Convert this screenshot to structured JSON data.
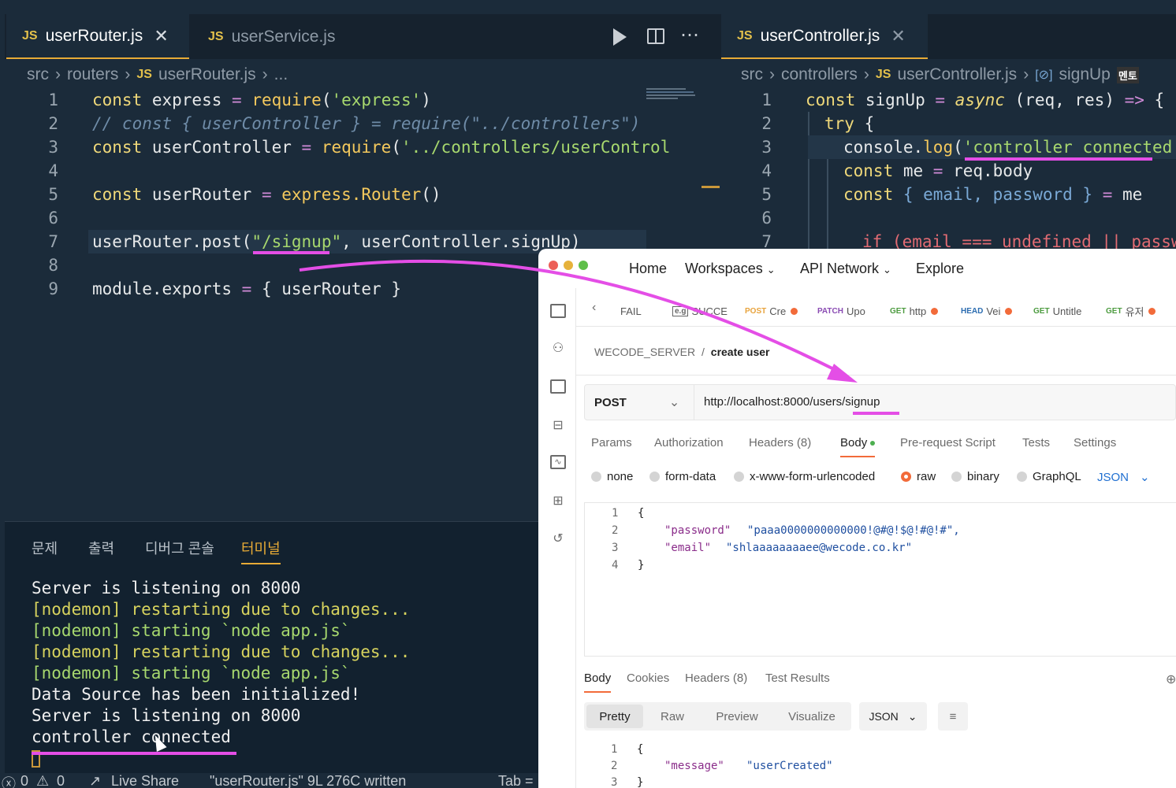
{
  "editor_left": {
    "tabs": [
      {
        "label": "userRouter.js",
        "lang": "JS"
      },
      {
        "label": "userService.js",
        "lang": "JS"
      }
    ],
    "breadcrumb": [
      "src",
      "routers",
      "userRouter.js",
      "..."
    ],
    "code": [
      {
        "n": "1",
        "text": ""
      },
      {
        "n": "2",
        "text": ""
      },
      {
        "n": "3",
        "text": ""
      },
      {
        "n": "4",
        "text": ""
      },
      {
        "n": "5",
        "text": ""
      },
      {
        "n": "6",
        "text": ""
      },
      {
        "n": "7",
        "text": ""
      },
      {
        "n": "8",
        "text": ""
      },
      {
        "n": "9",
        "text": ""
      }
    ],
    "l1": [
      "const",
      " express ",
      "=",
      " require",
      "(",
      "'express'",
      ")"
    ],
    "l2": "// const { userController } = require(\"../controllers\")",
    "l3": [
      "const",
      " userController ",
      "=",
      " require",
      "(",
      "'../controllers/userControl"
    ],
    "l5": [
      "const",
      " userRouter ",
      "=",
      " express.Router",
      "()"
    ],
    "l7": [
      "userRouter.post",
      "(",
      "\"/signup\"",
      ", userController.signUp",
      ")"
    ],
    "l9": [
      "module.exports ",
      "=",
      " { userRouter }"
    ]
  },
  "editor_right": {
    "tab": {
      "label": "userController.js",
      "lang": "JS"
    },
    "breadcrumb": [
      "src",
      "controllers",
      "userController.js",
      "signUp",
      "멘토"
    ],
    "l1": [
      "const",
      " signUp ",
      "=",
      " async",
      " (req, res) ",
      "=>",
      " {"
    ],
    "l2": [
      "try",
      " {"
    ],
    "l3": [
      "console.",
      "log",
      "(",
      "'controller connected'",
      ")"
    ],
    "l4": [
      "const",
      " me ",
      "=",
      " req.body"
    ],
    "l5": [
      "const",
      " { email, password } ",
      "=",
      " me"
    ],
    "l7": "if (email === undefined || passwo",
    "nums": [
      "1",
      "2",
      "3",
      "4",
      "5",
      "6",
      "7"
    ]
  },
  "terminal": {
    "tabs": [
      "문제",
      "출력",
      "디버그 콘솔",
      "터미널"
    ],
    "lines": [
      {
        "text": "Server is listening on 8000",
        "color": "#f0f0f0"
      },
      {
        "text": "[nodemon] restarting due to changes...",
        "color": "#d7d35e"
      },
      {
        "text": "[nodemon] starting `node app.js`",
        "color": "#a7d86e"
      },
      {
        "text": "[nodemon] restarting due to changes...",
        "color": "#d7d35e"
      },
      {
        "text": "[nodemon] starting `node app.js`",
        "color": "#a7d86e"
      },
      {
        "text": "Data Source has been initialized!",
        "color": "#f0f0f0"
      },
      {
        "text": "Server is listening on 8000",
        "color": "#f0f0f0"
      },
      {
        "text": "controller connected",
        "color": "#f0f0f0"
      }
    ]
  },
  "statusbar": {
    "problems": "0",
    "warnings": "0",
    "live_share": "Live Share",
    "file_msg": "\"userRouter.js\" 9L 276C written",
    "tab": "Tab ="
  },
  "postman": {
    "nav": [
      "Home",
      "Workspaces",
      "API Network",
      "Explore"
    ],
    "tabs": [
      {
        "method": "",
        "label": "FAIL"
      },
      {
        "method": "e.g",
        "label": "SUCCE"
      },
      {
        "method": "POST",
        "label": "Cre",
        "dot": true
      },
      {
        "method": "PATCH",
        "label": "Upo"
      },
      {
        "method": "GET",
        "label": "http",
        "dot": true
      },
      {
        "method": "HEAD",
        "label": "Vei",
        "dot": true
      },
      {
        "method": "GET",
        "label": "Untitle"
      },
      {
        "method": "GET",
        "label": "유저",
        "dot": true
      }
    ],
    "breadcrumb": {
      "workspace": "WECODE_SERVER",
      "separator": "/",
      "request": "create user"
    },
    "method": "POST",
    "url": "http://localhost:8000/users/signup",
    "subtabs": [
      "Params",
      "Authorization",
      "Headers (8)",
      "Body",
      "Pre-request Script",
      "Tests",
      "Settings"
    ],
    "body_types": [
      "none",
      "form-data",
      "x-www-form-urlencoded",
      "raw",
      "binary",
      "GraphQL"
    ],
    "body_format": "JSON",
    "body_lines": [
      {
        "n": "1",
        "text": "{"
      },
      {
        "n": "2",
        "key": "\"password\"",
        "val": "\"paaa0000000000000!@#@!$@!#@!#\","
      },
      {
        "n": "3",
        "key": "\"email\"",
        "val": "\"shlaaaaaaaaee@wecode.co.kr\""
      },
      {
        "n": "4",
        "text": "}"
      }
    ],
    "response_tabs": [
      "Body",
      "Cookies",
      "Headers (8)",
      "Test Results"
    ],
    "view_buttons": [
      "Pretty",
      "Raw",
      "Preview",
      "Visualize"
    ],
    "response_format": "JSON",
    "response_lines": [
      {
        "n": "1",
        "text": "{"
      },
      {
        "n": "2",
        "key": "\"message\"",
        "val": "\"userCreated\""
      },
      {
        "n": "3",
        "text": "}"
      }
    ]
  },
  "colors": {
    "annotation": "#e44ee6",
    "accent_tab": "#e8ab36",
    "postman_orange": "#f26b3a"
  }
}
